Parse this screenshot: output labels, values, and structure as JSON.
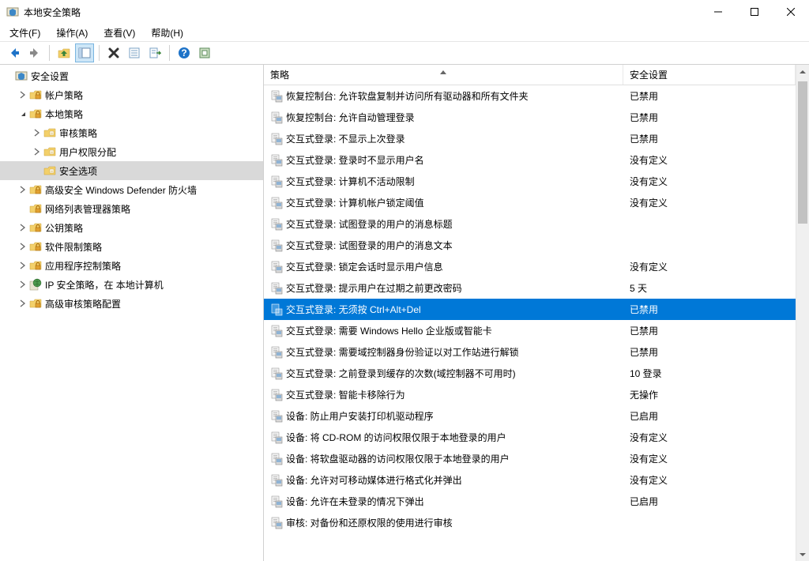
{
  "window": {
    "title": "本地安全策略"
  },
  "menu": {
    "file": "文件(F)",
    "action": "操作(A)",
    "view": "查看(V)",
    "help": "帮助(H)"
  },
  "tree": {
    "root": "安全设置",
    "items": [
      {
        "label": "帐户策略",
        "expandable": true,
        "expanded": false,
        "depth": 1
      },
      {
        "label": "本地策略",
        "expandable": true,
        "expanded": true,
        "depth": 1
      },
      {
        "label": "审核策略",
        "expandable": true,
        "expanded": false,
        "depth": 2
      },
      {
        "label": "用户权限分配",
        "expandable": true,
        "expanded": false,
        "depth": 2
      },
      {
        "label": "安全选项",
        "expandable": false,
        "expanded": false,
        "depth": 2,
        "selected": true
      },
      {
        "label": "高级安全 Windows Defender 防火墙",
        "expandable": true,
        "expanded": false,
        "depth": 1
      },
      {
        "label": "网络列表管理器策略",
        "expandable": false,
        "expanded": false,
        "depth": 1
      },
      {
        "label": "公钥策略",
        "expandable": true,
        "expanded": false,
        "depth": 1
      },
      {
        "label": "软件限制策略",
        "expandable": true,
        "expanded": false,
        "depth": 1
      },
      {
        "label": "应用程序控制策略",
        "expandable": true,
        "expanded": false,
        "depth": 1
      },
      {
        "label": "IP 安全策略，在 本地计算机",
        "expandable": true,
        "expanded": false,
        "depth": 1,
        "icon": "globe"
      },
      {
        "label": "高级审核策略配置",
        "expandable": true,
        "expanded": false,
        "depth": 1
      }
    ]
  },
  "list": {
    "headers": {
      "policy": "策略",
      "setting": "安全设置"
    },
    "rows": [
      {
        "policy": "恢复控制台: 允许软盘复制并访问所有驱动器和所有文件夹",
        "setting": "已禁用"
      },
      {
        "policy": "恢复控制台: 允许自动管理登录",
        "setting": "已禁用"
      },
      {
        "policy": "交互式登录: 不显示上次登录",
        "setting": "已禁用"
      },
      {
        "policy": "交互式登录: 登录时不显示用户名",
        "setting": "没有定义"
      },
      {
        "policy": "交互式登录: 计算机不活动限制",
        "setting": "没有定义"
      },
      {
        "policy": "交互式登录: 计算机帐户锁定阈值",
        "setting": "没有定义"
      },
      {
        "policy": "交互式登录: 试图登录的用户的消息标题",
        "setting": ""
      },
      {
        "policy": "交互式登录: 试图登录的用户的消息文本",
        "setting": ""
      },
      {
        "policy": "交互式登录: 锁定会话时显示用户信息",
        "setting": "没有定义"
      },
      {
        "policy": "交互式登录: 提示用户在过期之前更改密码",
        "setting": "5 天"
      },
      {
        "policy": "交互式登录: 无须按 Ctrl+Alt+Del",
        "setting": "已禁用",
        "selected": true
      },
      {
        "policy": "交互式登录: 需要 Windows Hello 企业版或智能卡",
        "setting": "已禁用"
      },
      {
        "policy": "交互式登录: 需要域控制器身份验证以对工作站进行解锁",
        "setting": "已禁用"
      },
      {
        "policy": "交互式登录: 之前登录到缓存的次数(域控制器不可用时)",
        "setting": "10 登录"
      },
      {
        "policy": "交互式登录: 智能卡移除行为",
        "setting": "无操作"
      },
      {
        "policy": "设备: 防止用户安装打印机驱动程序",
        "setting": "已启用"
      },
      {
        "policy": "设备: 将 CD-ROM 的访问权限仅限于本地登录的用户",
        "setting": "没有定义"
      },
      {
        "policy": "设备: 将软盘驱动器的访问权限仅限于本地登录的用户",
        "setting": "没有定义"
      },
      {
        "policy": "设备: 允许对可移动媒体进行格式化并弹出",
        "setting": "没有定义"
      },
      {
        "policy": "设备: 允许在未登录的情况下弹出",
        "setting": "已启用"
      },
      {
        "policy": "审核: 对备份和还原权限的使用进行审核",
        "setting": ""
      }
    ]
  }
}
